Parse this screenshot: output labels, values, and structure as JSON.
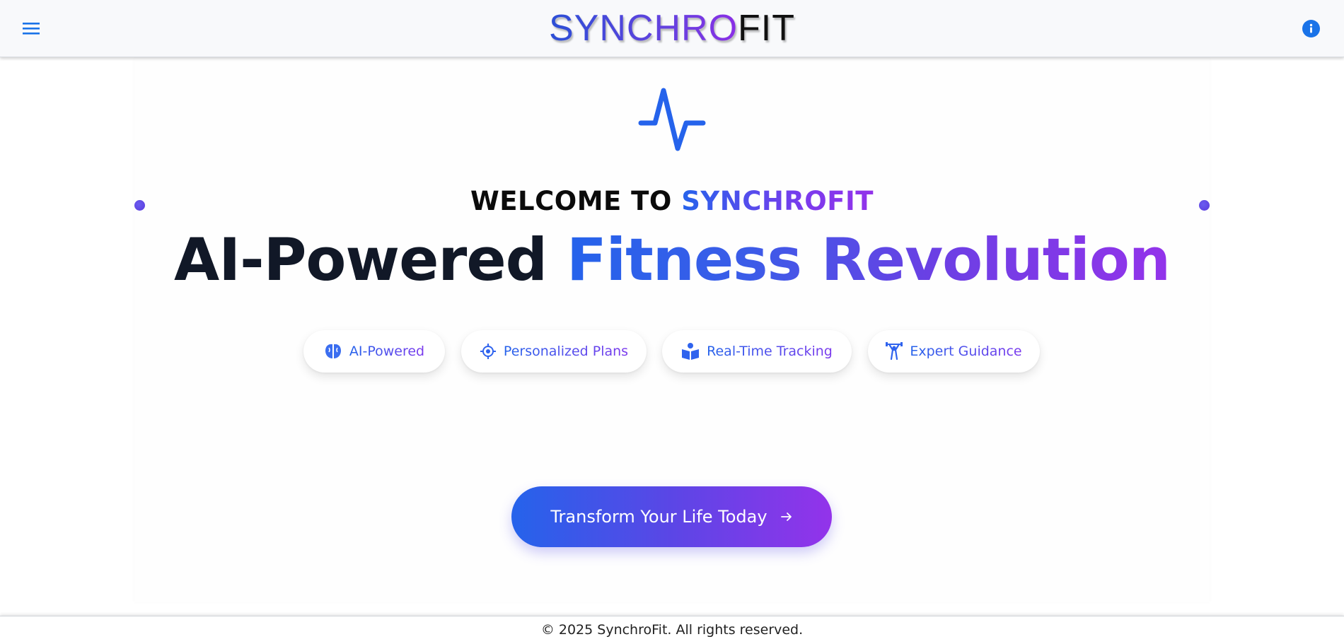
{
  "header": {
    "logo_part1": "SYNCHRO",
    "logo_part2": "FIT",
    "menu_icon": "hamburger-menu-icon",
    "info_icon": "info-icon"
  },
  "hero": {
    "pulse_icon": "activity-pulse-icon",
    "welcome_prefix": "WELCOME TO",
    "welcome_brand": "SYNCHROFIT",
    "headline_dark": "AI-Powered",
    "headline_gradient": "Fitness Revolution",
    "features": [
      {
        "label": "AI-Powered",
        "icon": "brain-icon"
      },
      {
        "label": "Personalized Plans",
        "icon": "target-icon"
      },
      {
        "label": "Real-Time Tracking",
        "icon": "tracking-icon"
      },
      {
        "label": "Expert Guidance",
        "icon": "weightlifter-icon"
      }
    ],
    "cta_label": "Transform Your Life Today",
    "cta_icon": "arrow-right-icon"
  },
  "footer": {
    "copyright": "© 2025 SynchroFit. All rights reserved."
  },
  "colors": {
    "brand_blue": "#2563eb",
    "brand_purple": "#9333ea",
    "header_bg": "#f8f9fb"
  }
}
